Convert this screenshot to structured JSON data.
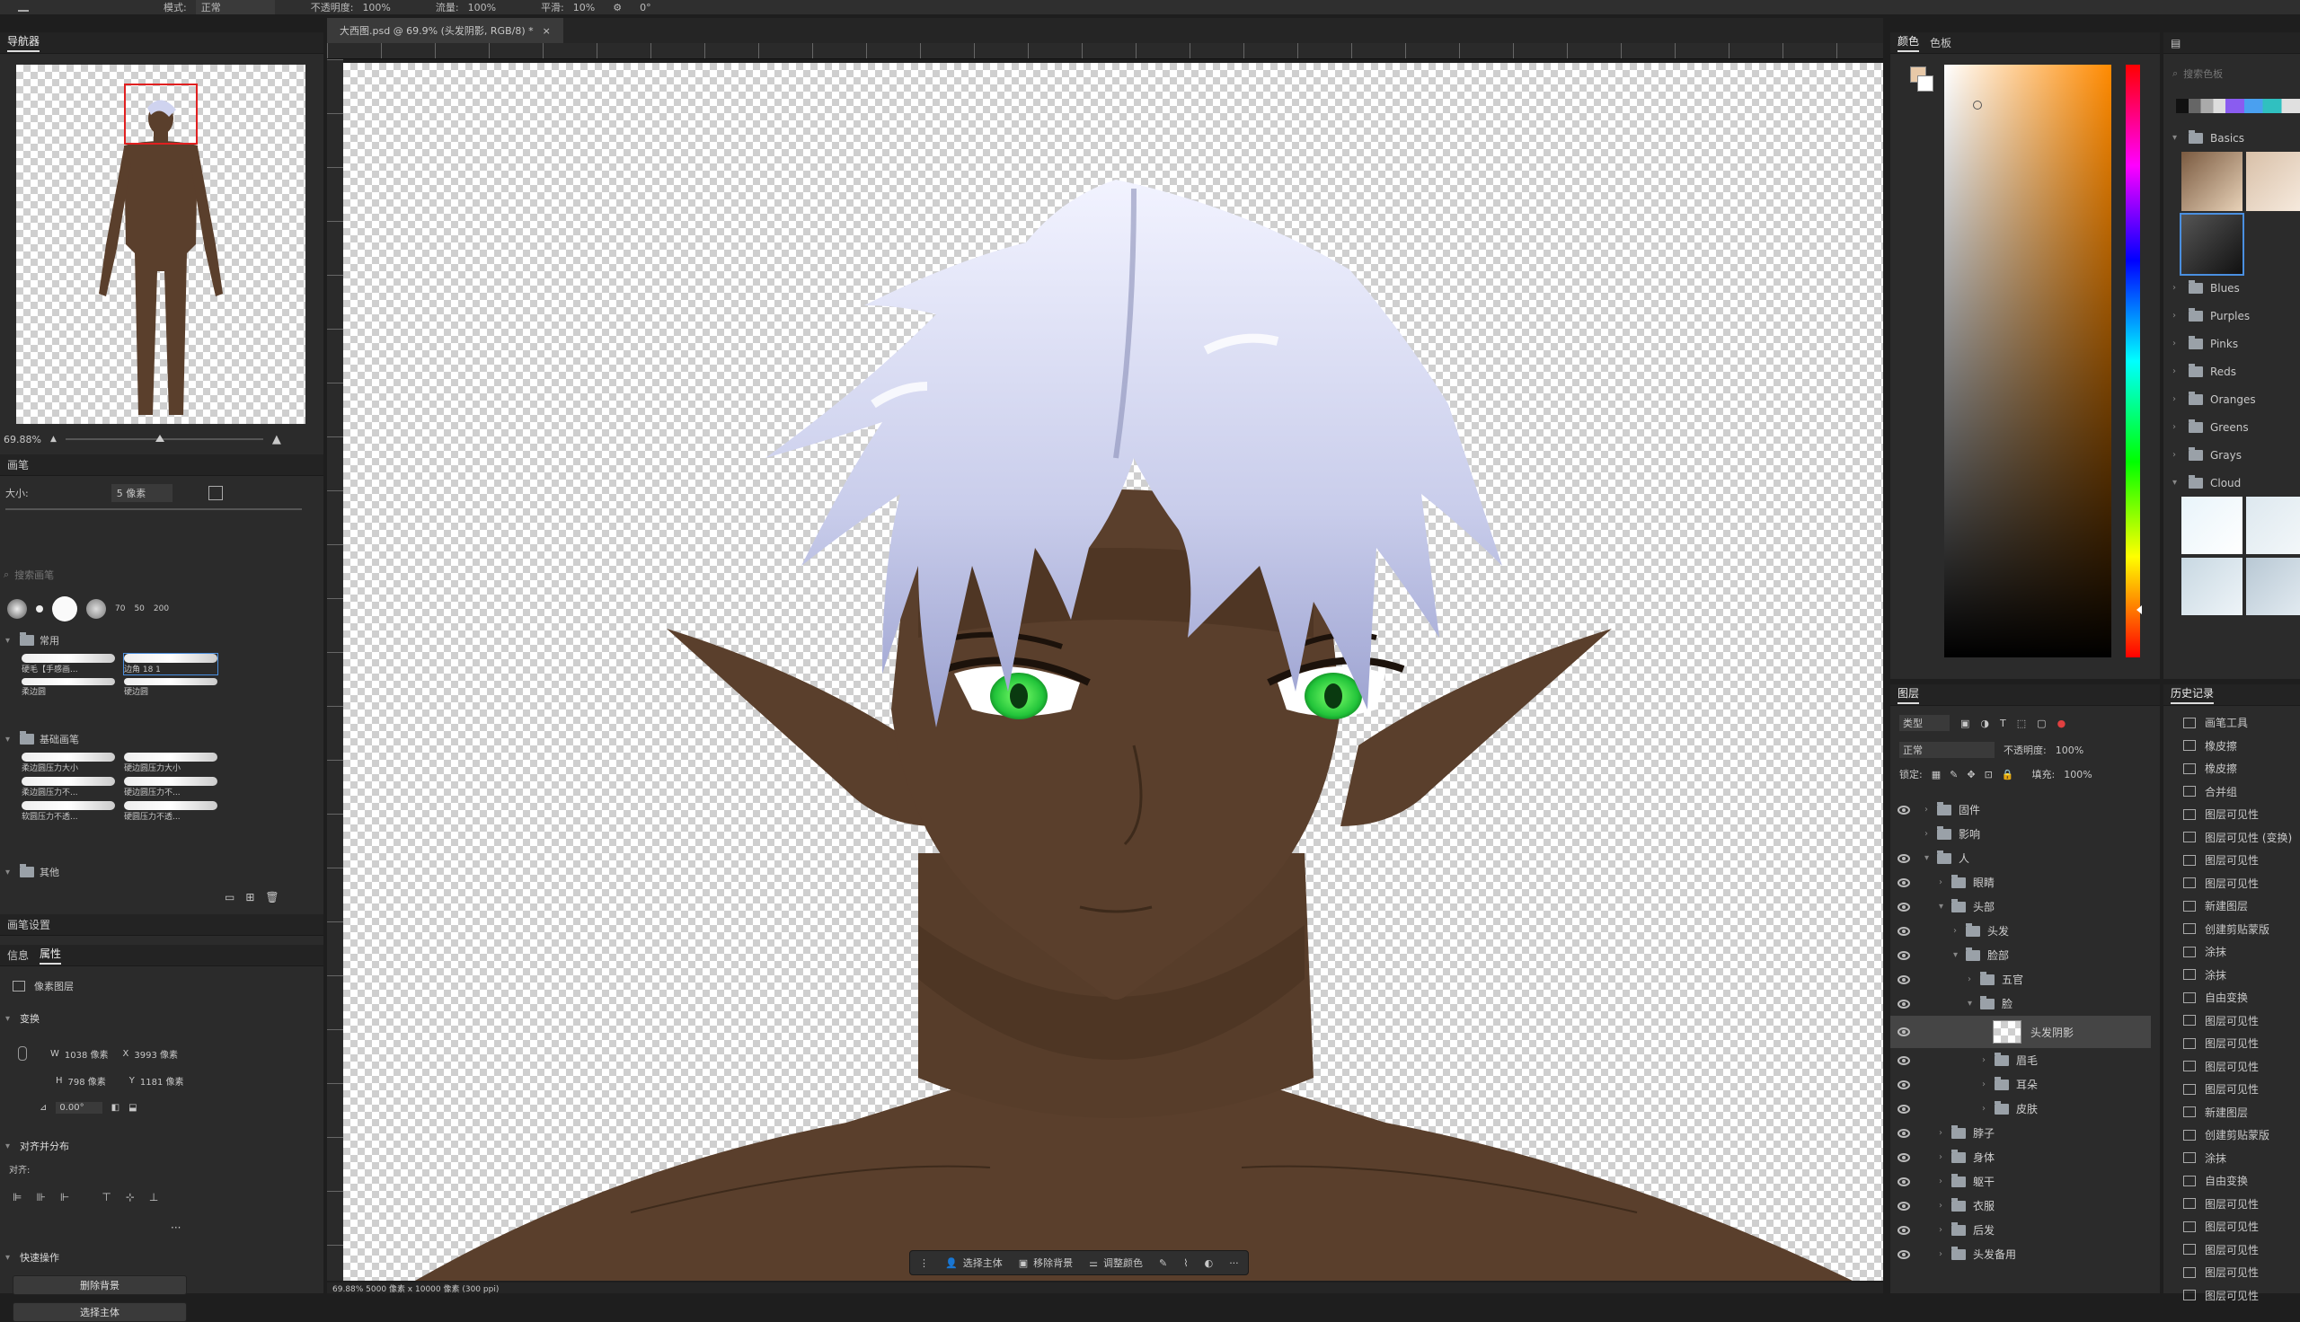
{
  "topbar": {
    "mode_label": "模式:",
    "mode_value": "正常",
    "opacity_label": "不透明度:",
    "opacity_value": "100%",
    "flow_label": "流量:",
    "flow_value": "100%",
    "smooth_label": "平滑:",
    "smooth_value": "10%",
    "angle_value": "0°"
  },
  "document_tab": {
    "title": "大西图.psd @ 69.9% (头发阴影, RGB/8) *"
  },
  "navigator": {
    "title": "导航器",
    "zoom": "69.88%"
  },
  "brushes": {
    "title": "画笔",
    "size_label": "大小:",
    "size_value": "5 像素",
    "search_placeholder": "搜索画笔",
    "preset_sizes": [
      "70",
      "50",
      "200"
    ],
    "group_general": "常用",
    "items_general": [
      "硬毛【手感画...",
      "边角 18 1",
      "柔边圆",
      "硬边圆"
    ],
    "group_pressure": "基础画笔",
    "items_pressure": [
      "柔边圆压力大小",
      "硬边圆压力大小",
      "柔边圆压力不...",
      "硬边圆压力不...",
      "软圆压力不透...",
      "硬圆压力不透..."
    ],
    "group_other": "其他"
  },
  "properties": {
    "panel_title": "画笔设置",
    "tab_info": "信息",
    "tab_props": "属性",
    "layer_type": "像素图层",
    "transform_title": "变换",
    "w_label": "W",
    "w_value": "1038 像素",
    "x_label": "X",
    "x_value": "3993 像素",
    "h_label": "H",
    "h_value": "798 像素",
    "y_label": "Y",
    "y_value": "1181 像素",
    "angle_value": "0.00°",
    "align_title": "对齐并分布",
    "align_sub": "对齐:",
    "quick_title": "快速操作",
    "quick_btn1": "删除背景",
    "quick_btn2": "选择主体"
  },
  "color_panel": {
    "tab1": "颜色",
    "tab2": "色板"
  },
  "swatches": {
    "search_placeholder": "搜索色板",
    "groups": [
      "Basics",
      "Blues",
      "Purples",
      "Pinks",
      "Reds",
      "Oranges",
      "Greens",
      "Grays",
      "Cloud"
    ]
  },
  "layers": {
    "title": "图层",
    "kind_label": "类型",
    "blend_mode": "正常",
    "opacity_label": "不透明度:",
    "opacity_value": "100%",
    "lock_label": "锁定:",
    "fill_label": "填充:",
    "fill_value": "100%",
    "items": [
      {
        "name": "固件",
        "indent": 0,
        "open": false,
        "eye": true
      },
      {
        "name": "影响",
        "indent": 0,
        "open": false,
        "eye": false
      },
      {
        "name": "人",
        "indent": 0,
        "open": true,
        "eye": true
      },
      {
        "name": "眼睛",
        "indent": 1,
        "open": false,
        "eye": true
      },
      {
        "name": "头部",
        "indent": 1,
        "open": true,
        "eye": true
      },
      {
        "name": "头发",
        "indent": 2,
        "open": false,
        "eye": true
      },
      {
        "name": "脸部",
        "indent": 2,
        "open": true,
        "eye": true
      },
      {
        "name": "五官",
        "indent": 3,
        "open": false,
        "eye": true
      },
      {
        "name": "脸",
        "indent": 3,
        "open": true,
        "eye": true
      },
      {
        "name": "头发阴影",
        "indent": 4,
        "thumb": true,
        "eye": true,
        "selected": true
      },
      {
        "name": "眉毛",
        "indent": 4,
        "open": false,
        "eye": true
      },
      {
        "name": "耳朵",
        "indent": 4,
        "open": false,
        "eye": true
      },
      {
        "name": "皮肤",
        "indent": 4,
        "open": false,
        "eye": true
      },
      {
        "name": "脖子",
        "indent": 1,
        "open": false,
        "eye": true
      },
      {
        "name": "身体",
        "indent": 1,
        "open": false,
        "eye": true
      },
      {
        "name": "躯干",
        "indent": 1,
        "open": false,
        "eye": true
      },
      {
        "name": "衣服",
        "indent": 1,
        "open": false,
        "eye": true
      },
      {
        "name": "后发",
        "indent": 1,
        "open": false,
        "eye": true
      },
      {
        "name": "头发备用",
        "indent": 1,
        "open": false,
        "eye": true
      }
    ]
  },
  "history": {
    "title": "历史记录",
    "items": [
      "画笔工具",
      "橡皮擦",
      "橡皮擦",
      "合并组",
      "图层可见性",
      "图层可见性 (变换)",
      "图层可见性",
      "图层可见性",
      "新建图层",
      "创建剪贴蒙版",
      "涂抹",
      "涂抹",
      "自由变换",
      "图层可见性",
      "图层可见性",
      "图层可见性",
      "图层可见性",
      "新建图层",
      "创建剪贴蒙版",
      "涂抹",
      "自由变换",
      "图层可见性",
      "图层可见性",
      "图层可见性",
      "图层可见性",
      "图层可见性"
    ]
  },
  "taskbar": {
    "btn1": "选择主体",
    "btn2": "移除背景",
    "btn3": "调整颜色"
  },
  "status": {
    "text": "69.88%   5000 像素 x 10000 像素 (300 ppi)"
  },
  "colors": {
    "skin": "#5a3f2c",
    "hair": "#cfd3ef",
    "eye": "#22c43a",
    "panel": "#2b2b2b",
    "canvas_bg": "#1f1f1f"
  }
}
